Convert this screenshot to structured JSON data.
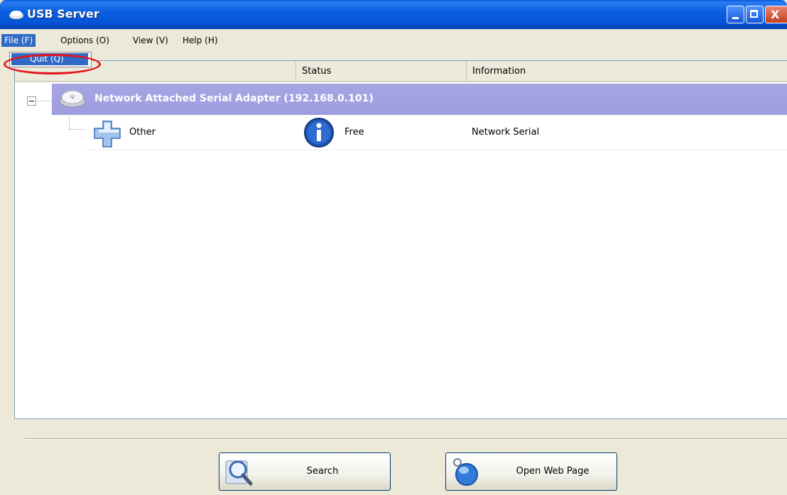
{
  "window": {
    "title": "USB Server",
    "icon": "usb-server-icon"
  },
  "menubar": {
    "items": [
      {
        "label": "File (F)"
      },
      {
        "label": "Options (O)"
      },
      {
        "label": "View (V)"
      },
      {
        "label": "Help (H)"
      }
    ]
  },
  "file_menu": {
    "items": [
      {
        "label": "Quit (Q)"
      }
    ]
  },
  "list": {
    "columns": [
      "",
      "Status",
      "Information"
    ],
    "group": {
      "label": "Network Attached Serial Adapter  (192.168.0.101)",
      "icon": "usb-hub-icon",
      "expanded": true
    },
    "rows": [
      {
        "name": "Other",
        "status": "Free",
        "information": "Network Serial",
        "icon": "puzzle-piece-icon",
        "status_icon": "info-icon"
      }
    ]
  },
  "buttons": {
    "search": {
      "label": "Search",
      "icon": "search-magnifier-icon"
    },
    "web": {
      "label": "Open Web Page",
      "icon": "globe-icon"
    }
  },
  "colors": {
    "titlebar": "#0554d6",
    "selection": "#316ac5",
    "group_row": "#a2a1e1",
    "annotation": "#e4141b"
  }
}
